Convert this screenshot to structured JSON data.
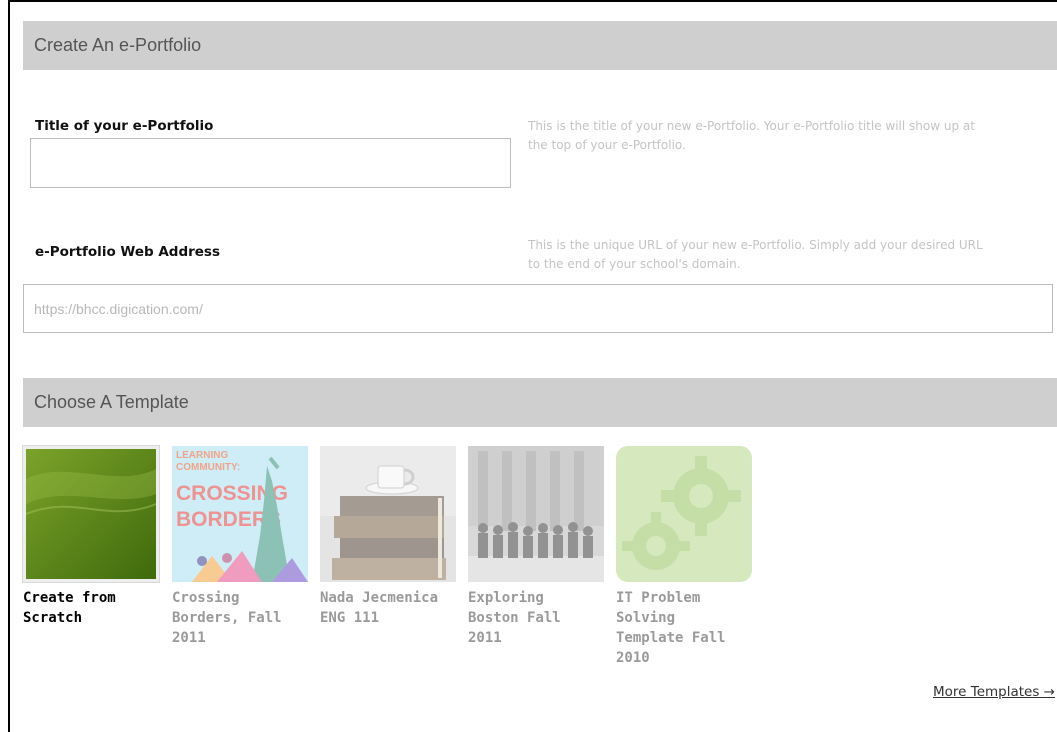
{
  "create_section": {
    "title": "Create An e-Portfolio"
  },
  "title_field": {
    "label": "Title of your e-Portfolio",
    "help": "This is the title of your new e-Portfolio. Your e-Portfolio title will show up at the top of your e-Portfolio.",
    "value": ""
  },
  "url_field": {
    "label": "e-Portfolio Web Address",
    "help": "This is the unique URL of your new e-Portfolio. Simply add your desired URL to the end of your school's domain.",
    "placeholder": "https://bhcc.digication.com/"
  },
  "template_section": {
    "title": "Choose A Template"
  },
  "templates": [
    {
      "name": "Create from Scratch",
      "selected": true,
      "thumb_icon": "green-gradient-thumbnail"
    },
    {
      "name": "Crossing Borders, Fall 2011",
      "selected": false,
      "thumb_icon": "crossing-borders-thumbnail",
      "thumb_text": [
        "LEARNING",
        "COMMUNITY:",
        "CROSSING",
        "BORDERS"
      ]
    },
    {
      "name": "Nada Jecmenica ENG 111",
      "selected": false,
      "thumb_icon": "books-and-cup-thumbnail"
    },
    {
      "name": "Exploring Boston Fall 2011",
      "selected": false,
      "thumb_icon": "group-photo-thumbnail"
    },
    {
      "name": "IT Problem Solving Template Fall 2010",
      "selected": false,
      "thumb_icon": "gears-thumbnail"
    }
  ],
  "more_templates": {
    "label": "More Templates →"
  },
  "colors": {
    "section_bar": "#cfcfcf",
    "help_text": "#c4c4c4",
    "selected_green": "#5f8a16"
  }
}
